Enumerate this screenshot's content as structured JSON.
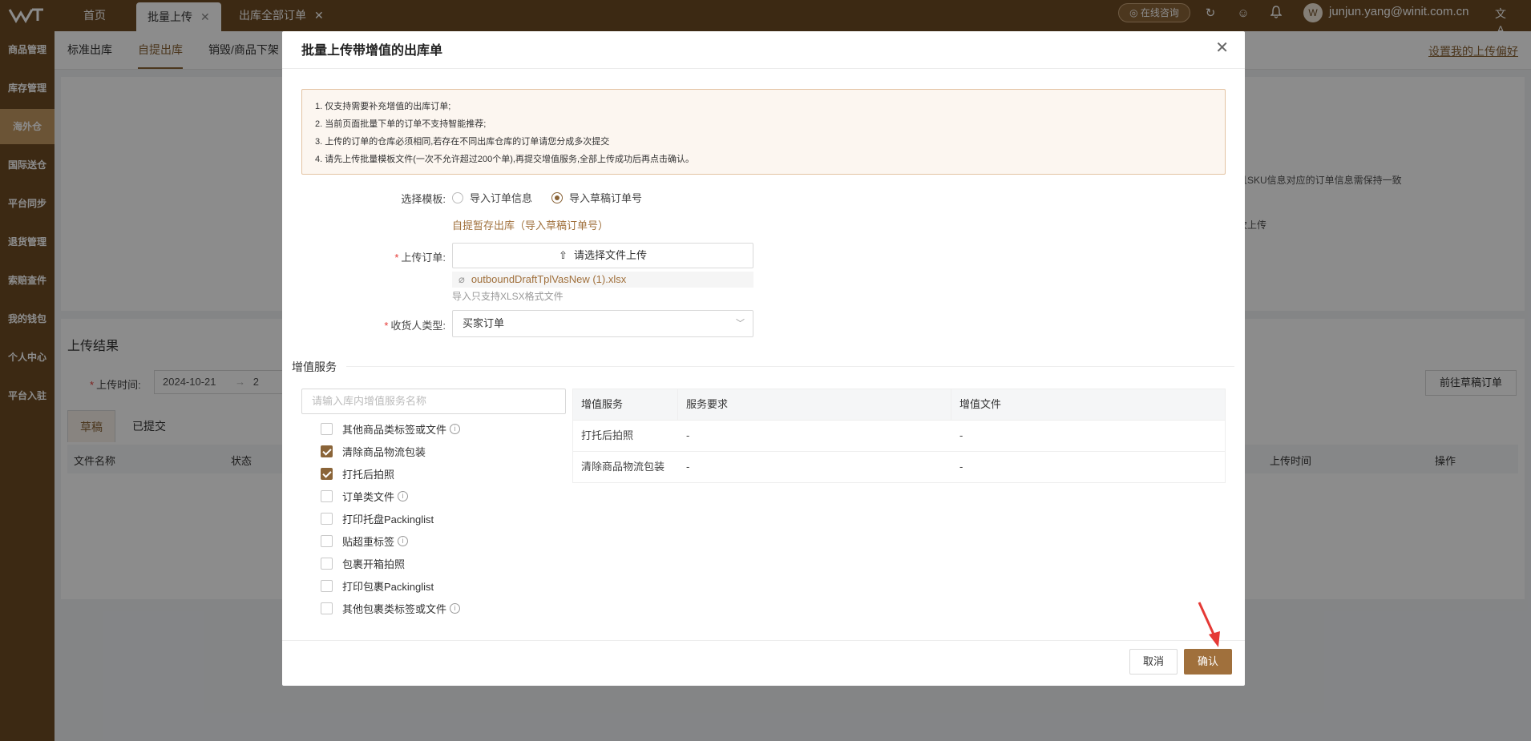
{
  "topbar": {
    "tabs": [
      {
        "label": "首页"
      },
      {
        "label": "批量上传"
      },
      {
        "label": "出库全部订单"
      }
    ],
    "consult_label": "在线咨询",
    "user_email": "junjun.yang@winit.com.cn",
    "avatar_text": "W"
  },
  "sidebar": {
    "items": [
      {
        "label": "商品管理"
      },
      {
        "label": "库存管理"
      },
      {
        "label": "海外仓"
      },
      {
        "label": "国际送仓"
      },
      {
        "label": "平台同步"
      },
      {
        "label": "退货管理"
      },
      {
        "label": "索赔查件"
      },
      {
        "label": "我的钱包"
      },
      {
        "label": "个人中心"
      },
      {
        "label": "平台入驻"
      }
    ],
    "active_index": 2
  },
  "page": {
    "subtabs": [
      {
        "label": "标准出库"
      },
      {
        "label": "自提出库"
      },
      {
        "label": "销毁/商品下架"
      }
    ],
    "prefs_link": "设置我的上传偏好",
    "hidden_text_1": "且SKU信息对应的订单信息需保持一致",
    "hidden_text_2": "次上传",
    "upload_result_title": "上传结果",
    "upload_time_label": "上传时间:",
    "upload_time_value": "2024-10-21",
    "date_arrow": "→",
    "date_end_partial": "2",
    "goto_draft_button": "前往草稿订单",
    "result_tabs": [
      {
        "label": "草稿"
      },
      {
        "label": "已提交"
      }
    ],
    "columns": {
      "file_name": "文件名称",
      "status": "状态",
      "upload_time": "上传时间",
      "action": "操作"
    }
  },
  "modal": {
    "title": "批量上传带增值的出库单",
    "notice": [
      "1. 仅支持需要补充增值的出库订单;",
      "2. 当前页面批量下单的订单不支持智能推荐;",
      "3. 上传的订单的仓库必须相同,若存在不同出库仓库的订单请您分成多次提交",
      "4. 请先上传批量模板文件(一次不允许超过200个单),再提交增值服务,全部上传成功后再点击确认。"
    ],
    "template_label": "选择模板:",
    "radio_options": [
      {
        "label": "导入订单信息",
        "checked": false
      },
      {
        "label": "导入草稿订单号",
        "checked": true
      }
    ],
    "template_link": "自提暂存出库（导入草稿订单号）",
    "upload_label": "上传订单:",
    "upload_button": "请选择文件上传",
    "file_name": "outboundDraftTplVasNew (1).xlsx",
    "upload_hint": "导入只支持XLSX格式文件",
    "consignee_label": "收货人类型:",
    "consignee_value": "买家订单",
    "vas_section_title": "增值服务",
    "vas_search_placeholder": "请输入库内增值服务名称",
    "vas_options": [
      {
        "label": "其他商品类标签或文件",
        "checked": false,
        "info": true
      },
      {
        "label": "清除商品物流包装",
        "checked": true,
        "info": false
      },
      {
        "label": "打托后拍照",
        "checked": true,
        "info": false
      },
      {
        "label": "订单类文件",
        "checked": false,
        "info": true
      },
      {
        "label": "打印托盘Packinglist",
        "checked": false,
        "info": false
      },
      {
        "label": "贴超重标签",
        "checked": false,
        "info": true
      },
      {
        "label": "包裹开箱拍照",
        "checked": false,
        "info": false
      },
      {
        "label": "打印包裹Packinglist",
        "checked": false,
        "info": false
      },
      {
        "label": "其他包裹类标签或文件",
        "checked": false,
        "info": true
      }
    ],
    "vas_table": {
      "headers": [
        "增值服务",
        "服务要求",
        "增值文件"
      ],
      "rows": [
        [
          "打托后拍照",
          "-",
          "-"
        ],
        [
          "清除商品物流包装",
          "-",
          "-"
        ]
      ]
    },
    "cancel_button": "取消",
    "confirm_button": "确认"
  },
  "colors": {
    "brand_brown": "#6e4c24",
    "accent": "#a0703c",
    "annotation_arrow": "#e53935"
  }
}
